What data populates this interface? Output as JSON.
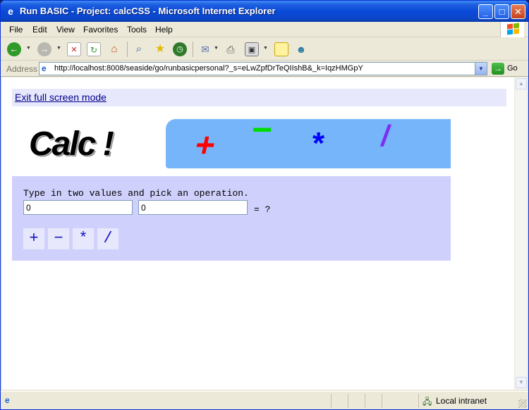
{
  "window": {
    "title": "Run BASIC - Project: calcCSS - Microsoft Internet Explorer",
    "minimize_icon": "minimize-icon",
    "maximize_icon": "maximize-icon",
    "close_icon": "close-icon"
  },
  "menu": {
    "items": [
      "File",
      "Edit",
      "View",
      "Favorites",
      "Tools",
      "Help"
    ]
  },
  "toolbar": {
    "icons": [
      "back-icon",
      "forward-icon",
      "stop-icon",
      "refresh-icon",
      "home-icon",
      "search-icon",
      "favorites-star-icon",
      "history-icon",
      "mail-icon",
      "print-icon",
      "edit-icon",
      "discuss-icon",
      "messenger-icon"
    ]
  },
  "address": {
    "label": "Address",
    "url": "http://localhost:8008/seaside/go/runbasicpersonal?_s=eLwZpfDrTeQIIshB&_k=IqzHMGpY",
    "go_label": "Go"
  },
  "page": {
    "exit_link": "Exit full screen mode",
    "banner": {
      "title": "Calc !",
      "ops": [
        "+",
        "−",
        "*",
        "/"
      ],
      "colors": {
        "plus": "#ff0000",
        "minus": "#00dd00",
        "times": "#0000ff",
        "divide": "#7b2ff0",
        "banner_bg": "#77b5fb"
      }
    },
    "calc": {
      "instruction": "Type in two values and pick an operation.",
      "value1": "0",
      "value2": "0",
      "result": "= ?",
      "buttons": [
        "+",
        "−",
        "*",
        "/"
      ]
    }
  },
  "status": {
    "zone": "Local intranet"
  }
}
